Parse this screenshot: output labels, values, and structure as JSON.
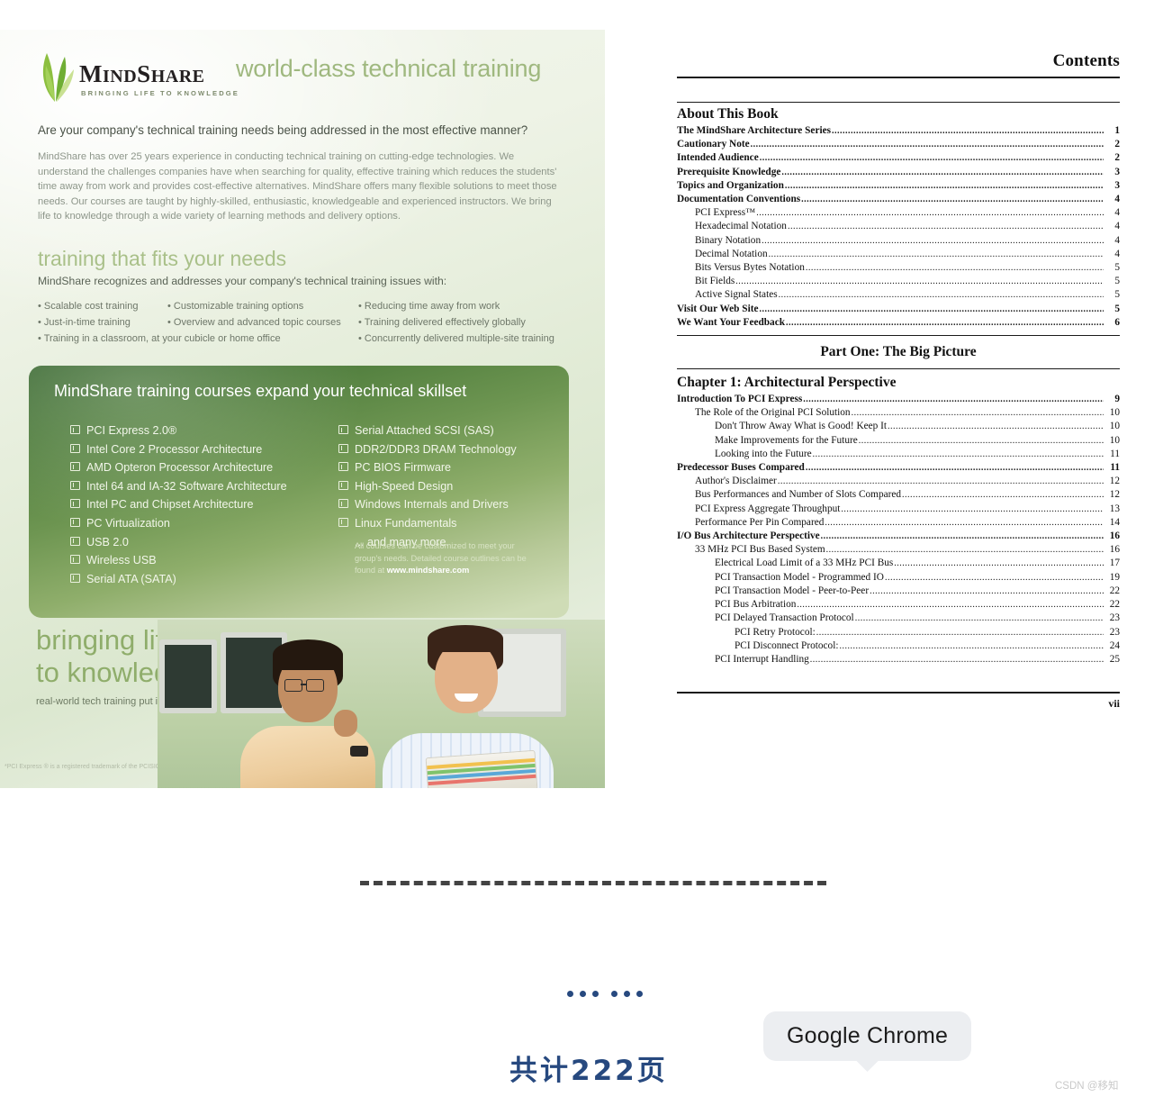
{
  "ad": {
    "logo_name": "MINDSHARE",
    "logo_tagline": "BRINGING LIFE TO KNOWLEDGE",
    "headline": "world-class technical training",
    "question": "Are your company's technical training needs being addressed in the most effective manner?",
    "paragraph": "MindShare has over 25 years experience in conducting technical training on cutting-edge technologies. We understand the challenges companies have when searching for quality, effective training which reduces the students' time away from work and provides cost-effective alternatives. MindShare offers many flexible solutions to meet those needs. Our courses are taught by highly-skilled, enthusiastic, knowledgeable and experienced instructors. We bring life to knowledge through a wide variety of learning methods and delivery options.",
    "section_heading": "training that fits your needs",
    "section_sub": "MindShare recognizes and addresses your company's technical training issues with:",
    "bullets": {
      "r1c1": "• Scalable cost training",
      "r1c2": "• Customizable training options",
      "r1c3": "• Reducing time away from work",
      "r2c1": "• Just-in-time training",
      "r2c2": "• Overview and advanced topic courses",
      "r2c3": "• Training delivered effectively globally",
      "r3c1": "• Training in a classroom, at your cubicle or home office",
      "r3c3": "• Concurrently delivered multiple-site training"
    },
    "course_box_title": "MindShare training courses expand your technical skillset",
    "courses_left": [
      "PCI Express 2.0®",
      "Intel Core 2 Processor Architecture",
      "AMD Opteron Processor Architecture",
      "Intel 64 and IA-32 Software Architecture",
      "Intel PC and Chipset Architecture",
      "PC Virtualization",
      "USB 2.0",
      "Wireless USB",
      "Serial ATA (SATA)"
    ],
    "courses_right": [
      "Serial Attached SCSI (SAS)",
      "DDR2/DDR3 DRAM Technology",
      "PC BIOS Firmware",
      "High-Speed Design",
      "Windows Internals and Drivers",
      "Linux Fundamentals"
    ],
    "courses_more": "... and many more.",
    "course_note_pre": "All courses can be customized to meet your group's needs. Detailed course outlines can be found at ",
    "course_note_site": "www.mindshare.com",
    "slogan_line1": "bringing life",
    "slogan_line2": "to knowledge.",
    "slogan_sub": "real-world tech training put into practice worldwide",
    "footnote": "*PCI Express ® is a registered trademark of the PCISIG"
  },
  "toc": {
    "header": "Contents",
    "about_heading": "About This Book",
    "about_entries": [
      {
        "label": "The MindShare Architecture Series",
        "page": "1",
        "level": 0
      },
      {
        "label": "Cautionary Note",
        "page": "2",
        "level": 0
      },
      {
        "label": "Intended Audience",
        "page": "2",
        "level": 0
      },
      {
        "label": "Prerequisite Knowledge",
        "page": "3",
        "level": 0
      },
      {
        "label": "Topics and Organization",
        "page": "3",
        "level": 0
      },
      {
        "label": "Documentation Conventions",
        "page": "4",
        "level": 0
      },
      {
        "label": "PCI Express™",
        "page": "4",
        "level": 1
      },
      {
        "label": "Hexadecimal Notation",
        "page": "4",
        "level": 1
      },
      {
        "label": "Binary Notation",
        "page": "4",
        "level": 1
      },
      {
        "label": "Decimal Notation",
        "page": "4",
        "level": 1
      },
      {
        "label": "Bits Versus Bytes Notation",
        "page": "5",
        "level": 1
      },
      {
        "label": "Bit Fields",
        "page": "5",
        "level": 1
      },
      {
        "label": "Active Signal States",
        "page": "5",
        "level": 1
      },
      {
        "label": "Visit Our Web Site",
        "page": "5",
        "level": 0
      },
      {
        "label": "We Want Your Feedback",
        "page": "6",
        "level": 0
      }
    ],
    "part_title": "Part One: The Big Picture",
    "chapter_heading": "Chapter 1: Architectural Perspective",
    "chapter_entries": [
      {
        "label": "Introduction To PCI Express",
        "page": "9",
        "level": 0
      },
      {
        "label": "The Role of the Original PCI Solution",
        "page": "10",
        "level": 1
      },
      {
        "label": "Don't Throw Away What is Good! Keep It",
        "page": "10",
        "level": 2
      },
      {
        "label": "Make Improvements for the Future",
        "page": "10",
        "level": 2
      },
      {
        "label": "Looking into the Future",
        "page": "11",
        "level": 2
      },
      {
        "label": "Predecessor Buses Compared",
        "page": "11",
        "level": 0
      },
      {
        "label": "Author's Disclaimer",
        "page": "12",
        "level": 1
      },
      {
        "label": "Bus Performances and Number of Slots Compared",
        "page": "12",
        "level": 1
      },
      {
        "label": "PCI Express Aggregate Throughput",
        "page": "13",
        "level": 1
      },
      {
        "label": "Performance Per Pin Compared",
        "page": "14",
        "level": 1
      },
      {
        "label": "I/O Bus Architecture Perspective",
        "page": "16",
        "level": 0
      },
      {
        "label": "33 MHz PCI Bus Based System",
        "page": "16",
        "level": 1
      },
      {
        "label": "Electrical Load Limit of a 33 MHz PCI Bus",
        "page": "17",
        "level": 2
      },
      {
        "label": "PCI Transaction Model - Programmed IO",
        "page": "19",
        "level": 2
      },
      {
        "label": "PCI Transaction Model - Peer-to-Peer",
        "page": "22",
        "level": 2
      },
      {
        "label": "PCI Bus Arbitration",
        "page": "22",
        "level": 2
      },
      {
        "label": "PCI Delayed Transaction Protocol",
        "page": "23",
        "level": 2
      },
      {
        "label": "PCI Retry Protocol:",
        "page": "23",
        "level": 3
      },
      {
        "label": "PCI Disconnect Protocol:",
        "page": "24",
        "level": 3
      },
      {
        "label": "PCI Interrupt Handling",
        "page": "25",
        "level": 2
      }
    ],
    "folio": "vii"
  },
  "overlay": {
    "page_count": "共计222页",
    "tooltip": "Google Chrome",
    "watermark": "CSDN @移知",
    "accent_color": "#27497f"
  }
}
